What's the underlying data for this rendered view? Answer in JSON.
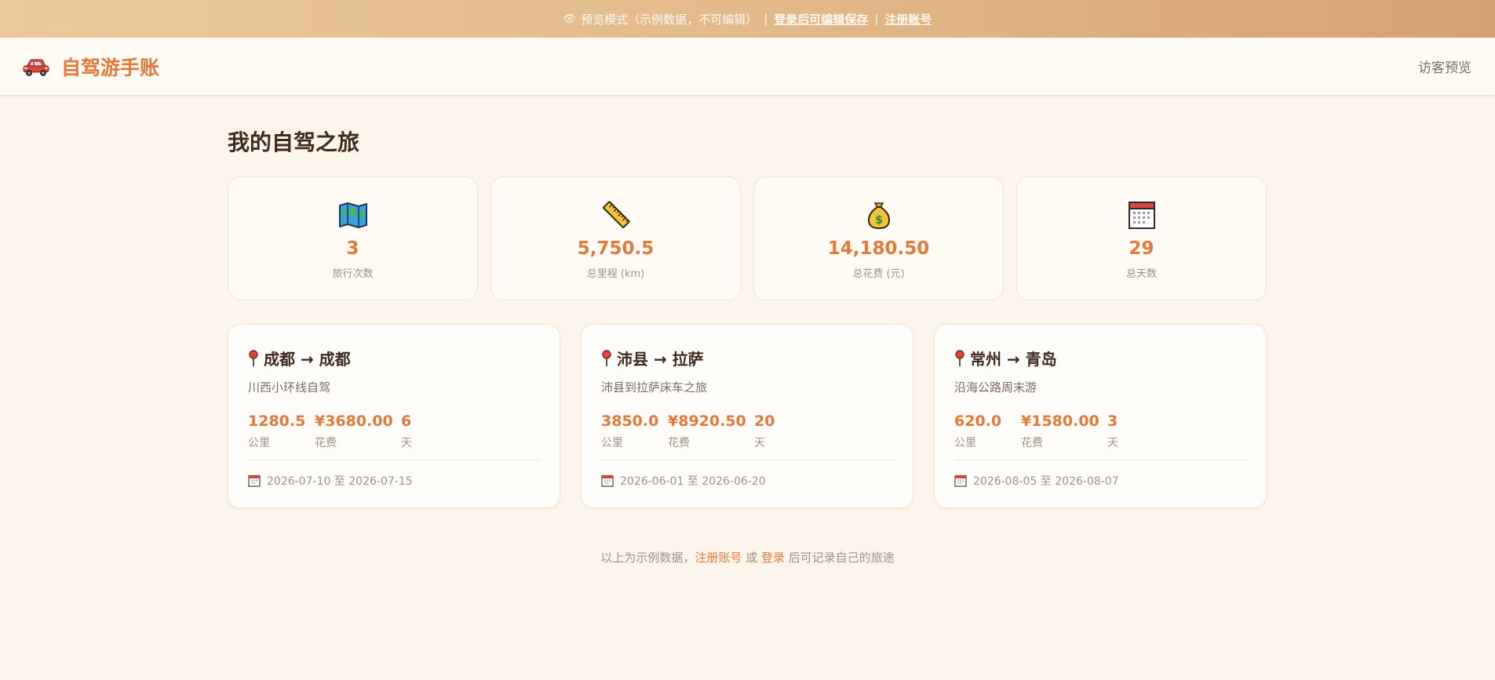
{
  "banner": {
    "eye_icon": "eye-icon",
    "text": "预览模式（示例数据，不可编辑）",
    "sep1": "|",
    "login_link": "登录后可编辑保存",
    "sep2": "|",
    "register_link": "注册账号"
  },
  "header": {
    "logo_icon": "car-icon",
    "app_title": "自驾游手账",
    "guest_label": "访客预览"
  },
  "page_title": "我的自驾之旅",
  "stats": [
    {
      "icon": "map-icon",
      "value": "3",
      "label": "旅行次数"
    },
    {
      "icon": "ruler-icon",
      "value": "5,750.5",
      "label": "总里程 (km)"
    },
    {
      "icon": "money-bag-icon",
      "value": "14,180.50",
      "label": "总花费 (元)"
    },
    {
      "icon": "calendar-icon",
      "value": "29",
      "label": "总天数"
    }
  ],
  "trips": [
    {
      "route": "成都 → 成都",
      "desc": "川西小环线自驾",
      "distance": "1280.5",
      "distance_unit": "公里",
      "cost": "¥3680.00",
      "cost_unit": "花费",
      "days": "6",
      "days_unit": "天",
      "dates": "2026-07-10 至 2026-07-15"
    },
    {
      "route": "沛县 → 拉萨",
      "desc": "沛县到拉萨床车之旅",
      "distance": "3850.0",
      "distance_unit": "公里",
      "cost": "¥8920.50",
      "cost_unit": "花费",
      "days": "20",
      "days_unit": "天",
      "dates": "2026-06-01 至 2026-06-20"
    },
    {
      "route": "常州 → 青岛",
      "desc": "沿海公路周末游",
      "distance": "620.0",
      "distance_unit": "公里",
      "cost": "¥1580.00",
      "cost_unit": "花费",
      "days": "3",
      "days_unit": "天",
      "dates": "2026-08-05 至 2026-08-07"
    }
  ],
  "footer": {
    "prefix": "以上为示例数据，",
    "register_link": "注册账号",
    "or": " 或 ",
    "login_link": "登录",
    "suffix": " 后可记录自己的旅途"
  },
  "colors": {
    "accent": "#e07a3a",
    "background": "#fdf5ec",
    "banner_start": "#ebc99c",
    "banner_end": "#d6a172"
  }
}
